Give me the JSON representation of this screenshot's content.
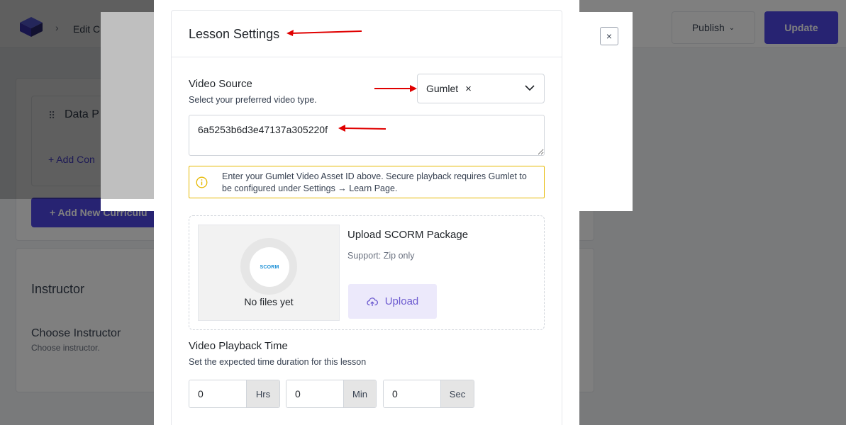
{
  "background": {
    "breadcrumb": "Edit C",
    "publish_label": "Publish",
    "update_label": "Update",
    "curriculum_item": "Data P",
    "add_content": "+ Add Con",
    "add_curriculum": "+ Add New Curriculu",
    "instructor_heading": "Instructor",
    "choose_instructor": "Choose Instructor",
    "choose_instructor_sub": "Choose instructor."
  },
  "modal": {
    "close_glyph": "×"
  },
  "lesson_settings": {
    "title": "Lesson Settings",
    "video_source": {
      "label": "Video Source",
      "description": "Select your preferred video type.",
      "selected": "Gumlet",
      "clear_glyph": "×"
    },
    "video_id": {
      "value": "6a5253b6d3e47137a305220f"
    },
    "notice": {
      "text": "Enter your Gumlet Video Asset ID above. Secure playback requires Gumlet to be configured under Settings → Learn Page."
    },
    "scorm": {
      "logo_text": "SCORM",
      "empty_text": "No files yet",
      "title": "Upload SCORM Package",
      "support": "Support: Zip only",
      "upload_label": "Upload"
    },
    "playback": {
      "label": "Video Playback Time",
      "description": "Set the expected time duration for this lesson",
      "hours": {
        "value": "0",
        "unit": "Hrs"
      },
      "minutes": {
        "value": "0",
        "unit": "Min"
      },
      "seconds": {
        "value": "0",
        "unit": "Sec"
      }
    }
  },
  "colors": {
    "accent": "#4f46e5",
    "annotation_arrow": "#e00000",
    "notice_border": "#e6b800"
  }
}
